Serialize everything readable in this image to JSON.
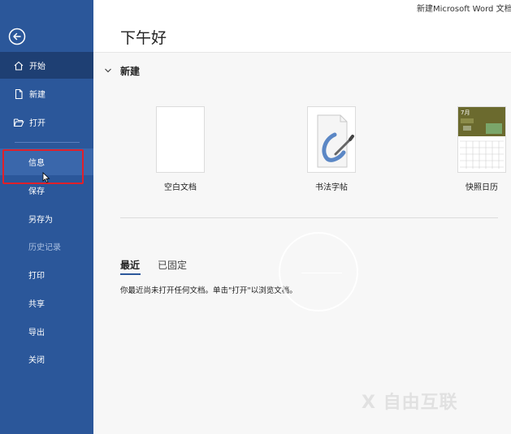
{
  "window": {
    "title": "新建Microsoft Word 文档"
  },
  "sidebar": {
    "back_icon": "back-arrow-icon",
    "items": [
      {
        "label": "开始",
        "icon": "home-icon",
        "state": "active"
      },
      {
        "label": "新建",
        "icon": "new-document-icon",
        "state": "normal"
      },
      {
        "label": "打开",
        "icon": "open-folder-icon",
        "state": "normal"
      },
      {
        "label": "信息",
        "state": "selected"
      },
      {
        "label": "保存",
        "state": "normal"
      },
      {
        "label": "另存为",
        "state": "normal"
      },
      {
        "label": "历史记录",
        "state": "disabled"
      },
      {
        "label": "打印",
        "state": "normal"
      },
      {
        "label": "共享",
        "state": "normal"
      },
      {
        "label": "导出",
        "state": "normal"
      },
      {
        "label": "关闭",
        "state": "normal"
      }
    ]
  },
  "main": {
    "greeting": "下午好",
    "new_section": {
      "title": "新建",
      "templates": [
        {
          "label": "空白文档"
        },
        {
          "label": "书法字帖"
        },
        {
          "label": "快照日历",
          "header_text": "7月"
        }
      ]
    },
    "tabs": [
      {
        "label": "最近",
        "active": true
      },
      {
        "label": "已固定",
        "active": false
      }
    ],
    "empty_message": "你最近尚未打开任何文档。单击\"打开\"以浏览文档。"
  },
  "colors": {
    "sidebar": "#2b579a",
    "sidebar_active": "#1e3f73",
    "highlight": "#e0202a"
  },
  "watermark": "X 自由互联"
}
